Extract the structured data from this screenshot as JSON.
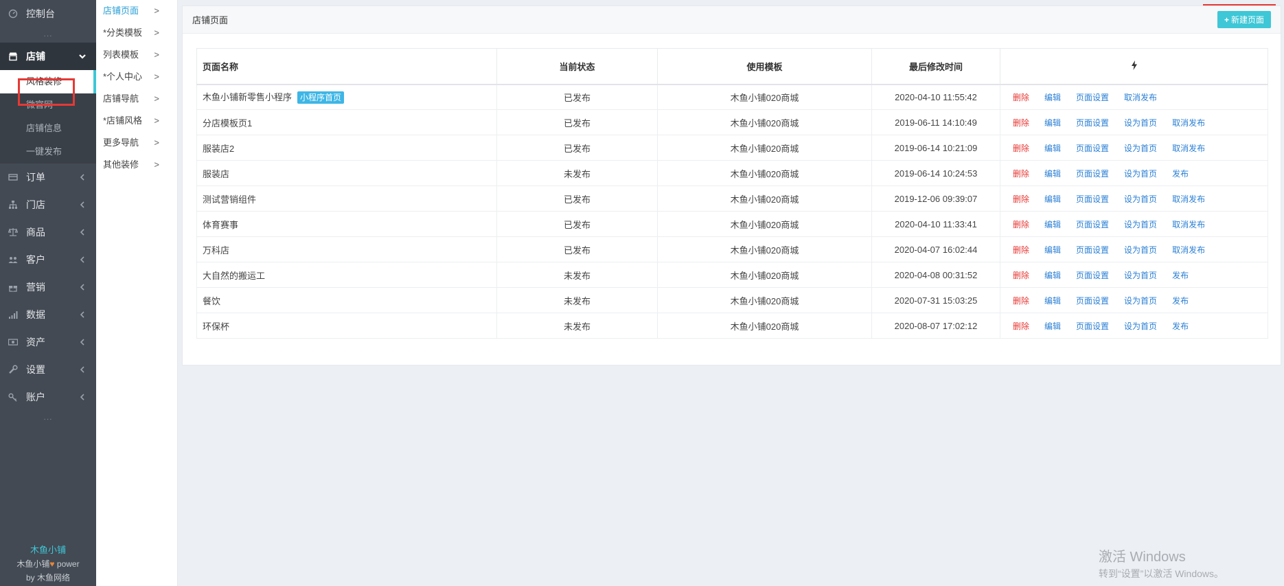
{
  "sidebar": {
    "items": [
      {
        "label": "控制台",
        "icon": "dashboard-icon"
      },
      {
        "label": "店铺",
        "icon": "store-icon"
      },
      {
        "label": "订单",
        "icon": "order-icon"
      },
      {
        "label": "门店",
        "icon": "branch-icon"
      },
      {
        "label": "商品",
        "icon": "scale-icon"
      },
      {
        "label": "客户",
        "icon": "users-icon"
      },
      {
        "label": "营销",
        "icon": "gift-icon"
      },
      {
        "label": "数据",
        "icon": "signal-icon"
      },
      {
        "label": "资产",
        "icon": "money-icon"
      },
      {
        "label": "设置",
        "icon": "wrench-icon"
      },
      {
        "label": "账户",
        "icon": "key-icon"
      }
    ],
    "store_sub": [
      "风格装修",
      "微官网",
      "店铺信息",
      "一键发布"
    ],
    "separator": "...",
    "footer": {
      "brand": "木鱼小铺",
      "line2": "木鱼小铺",
      "power": "power",
      "line3": "by 木鱼网络"
    }
  },
  "menu2": {
    "items": [
      "店铺页面",
      "*分类模板",
      "列表模板",
      "*个人中心",
      "店铺导航",
      "*店铺风格",
      "更多导航",
      "其他装修"
    ],
    "arrow": ">"
  },
  "panel": {
    "title": "店铺页面",
    "new_button": "新建页面",
    "columns": {
      "name": "页面名称",
      "status": "当前状态",
      "template": "使用模板",
      "time": "最后修改时间",
      "ops_icon": "lightning-icon"
    },
    "rows": [
      {
        "name": "木鱼小铺新零售小程序",
        "tag": "小程序首页",
        "status": "已发布",
        "template": "木鱼小铺020商城",
        "time": "2020-04-10 11:55:42",
        "ops": [
          "删除",
          "编辑",
          "页面设置",
          "取消发布"
        ]
      },
      {
        "name": "分店模板页1",
        "status": "已发布",
        "template": "木鱼小铺020商城",
        "time": "2019-06-11 14:10:49",
        "ops": [
          "删除",
          "编辑",
          "页面设置",
          "设为首页",
          "取消发布"
        ]
      },
      {
        "name": "服装店2",
        "status": "已发布",
        "template": "木鱼小铺020商城",
        "time": "2019-06-14 10:21:09",
        "ops": [
          "删除",
          "编辑",
          "页面设置",
          "设为首页",
          "取消发布"
        ]
      },
      {
        "name": "服装店",
        "status": "未发布",
        "template": "木鱼小铺020商城",
        "time": "2019-06-14 10:24:53",
        "ops": [
          "删除",
          "编辑",
          "页面设置",
          "设为首页",
          "发布"
        ]
      },
      {
        "name": "测试营销组件",
        "status": "已发布",
        "template": "木鱼小铺020商城",
        "time": "2019-12-06 09:39:07",
        "ops": [
          "删除",
          "编辑",
          "页面设置",
          "设为首页",
          "取消发布"
        ]
      },
      {
        "name": "体育赛事",
        "status": "已发布",
        "template": "木鱼小铺020商城",
        "time": "2020-04-10 11:33:41",
        "ops": [
          "删除",
          "编辑",
          "页面设置",
          "设为首页",
          "取消发布"
        ]
      },
      {
        "name": "万科店",
        "status": "已发布",
        "template": "木鱼小铺020商城",
        "time": "2020-04-07 16:02:44",
        "ops": [
          "删除",
          "编辑",
          "页面设置",
          "设为首页",
          "取消发布"
        ]
      },
      {
        "name": "大自然的搬运工",
        "status": "未发布",
        "template": "木鱼小铺020商城",
        "time": "2020-04-08 00:31:52",
        "ops": [
          "删除",
          "编辑",
          "页面设置",
          "设为首页",
          "发布"
        ]
      },
      {
        "name": "餐饮",
        "status": "未发布",
        "template": "木鱼小铺020商城",
        "time": "2020-07-31 15:03:25",
        "ops": [
          "删除",
          "编辑",
          "页面设置",
          "设为首页",
          "发布"
        ]
      },
      {
        "name": "环保杯",
        "status": "未发布",
        "template": "木鱼小铺020商城",
        "time": "2020-08-07 17:02:12",
        "ops": [
          "删除",
          "编辑",
          "页面设置",
          "设为首页",
          "发布"
        ]
      }
    ]
  },
  "watermark": {
    "line1": "激活 Windows",
    "line2": "转到“设置”以激活 Windows。"
  },
  "colors": {
    "sidebar": "#434a54",
    "accent": "#3ec7d6",
    "link": "#2a7fd4",
    "danger": "#e53935",
    "highlight_box": "#e53935"
  }
}
